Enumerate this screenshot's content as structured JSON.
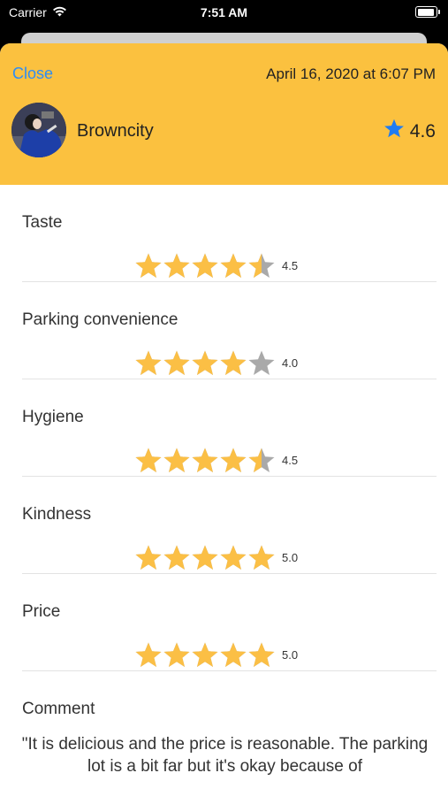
{
  "status": {
    "carrier": "Carrier",
    "time": "7:51 AM"
  },
  "header": {
    "close_label": "Close",
    "date": "April 16, 2020 at 6:07 PM",
    "username": "Browncity",
    "overall_rating": "4.6",
    "accent_color": "#fbc13f",
    "link_color": "#2d8df6",
    "star_icon_color": "#1f7cf2"
  },
  "ratings": [
    {
      "label": "Taste",
      "score": "4.5",
      "value": 4.5
    },
    {
      "label": "Parking convenience",
      "score": "4.0",
      "value": 4.0
    },
    {
      "label": "Hygiene",
      "score": "4.5",
      "value": 4.5
    },
    {
      "label": "Kindness",
      "score": "5.0",
      "value": 5.0
    },
    {
      "label": "Price",
      "score": "5.0",
      "value": 5.0
    }
  ],
  "comment": {
    "label": "Comment",
    "text": "\"It is delicious and the price is reasonable. The parking lot is a bit far but it's okay because of"
  },
  "colors": {
    "star_filled": "#fbbf45",
    "star_empty": "#a9a9a9"
  }
}
